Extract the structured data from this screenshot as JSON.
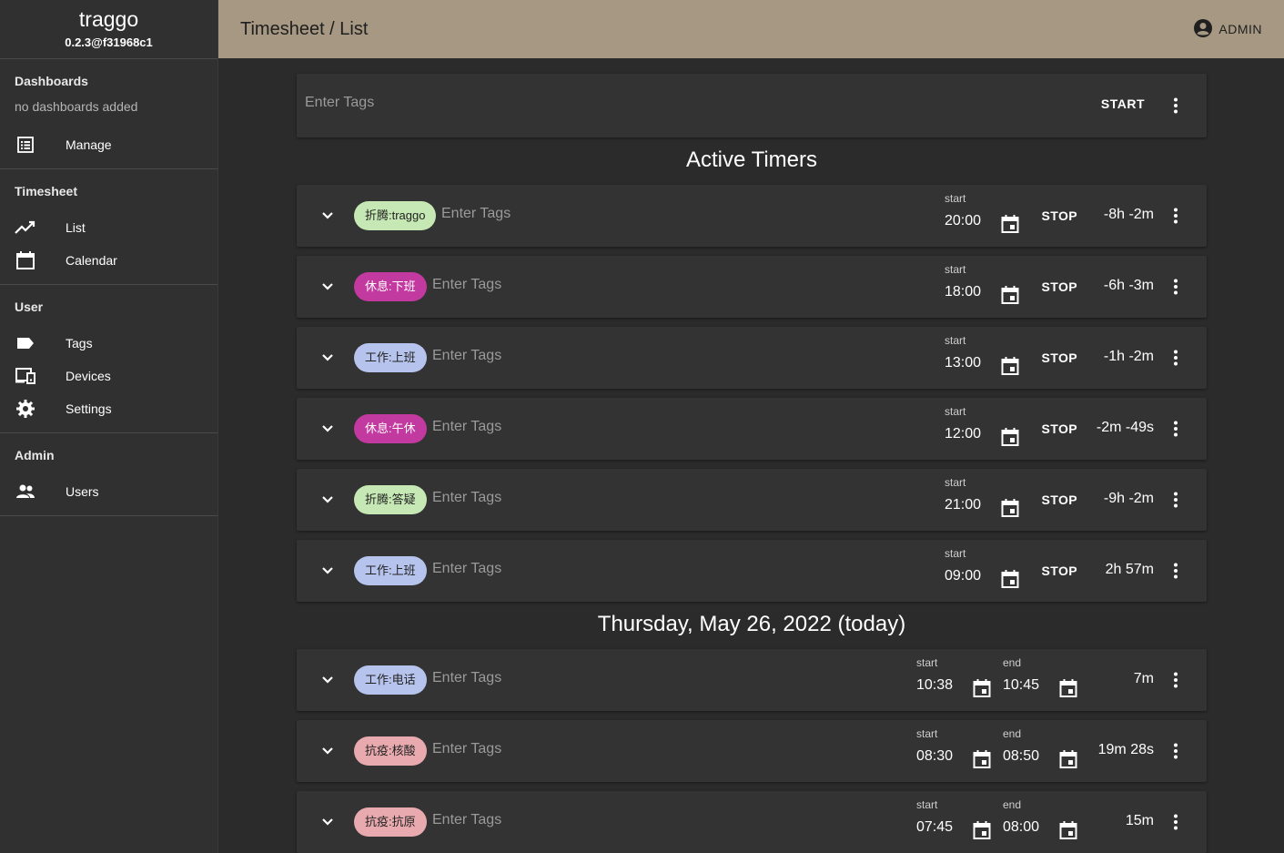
{
  "app": {
    "title": "traggo",
    "version": "0.2.3@f31968c1"
  },
  "sidebar": {
    "dashboards": {
      "heading": "Dashboards",
      "note": "no dashboards added",
      "items": [
        {
          "label": "Manage",
          "icon": "list-icon"
        }
      ]
    },
    "timesheet": {
      "heading": "Timesheet",
      "items": [
        {
          "label": "List",
          "icon": "trending-icon"
        },
        {
          "label": "Calendar",
          "icon": "calendar-icon"
        }
      ]
    },
    "user": {
      "heading": "User",
      "items": [
        {
          "label": "Tags",
          "icon": "label-icon"
        },
        {
          "label": "Devices",
          "icon": "devices-icon"
        },
        {
          "label": "Settings",
          "icon": "gear-icon"
        }
      ]
    },
    "admin": {
      "heading": "Admin",
      "items": [
        {
          "label": "Users",
          "icon": "people-icon"
        }
      ]
    }
  },
  "header": {
    "title": "Timesheet / List",
    "user_label": "ADMIN"
  },
  "tracker": {
    "placeholder": "Enter Tags",
    "start_label": "START"
  },
  "active_section": {
    "title": "Active Timers"
  },
  "active_timers": [
    {
      "tag": "折腾:traggo",
      "tag_color": "#c5e8b4",
      "placeholder": "Enter Tags",
      "start_label": "start",
      "start": "20:00",
      "stop_label": "STOP",
      "duration": "-8h -2m"
    },
    {
      "tag": "休息:下班",
      "tag_color": "#c2399f",
      "placeholder": "Enter Tags",
      "start_label": "start",
      "start": "18:00",
      "stop_label": "STOP",
      "duration": "-6h -3m"
    },
    {
      "tag": "工作:上班",
      "tag_color": "#b6c3ec",
      "placeholder": "Enter Tags",
      "start_label": "start",
      "start": "13:00",
      "stop_label": "STOP",
      "duration": "-1h -2m"
    },
    {
      "tag": "休息:午休",
      "tag_color": "#c2399f",
      "placeholder": "Enter Tags",
      "start_label": "start",
      "start": "12:00",
      "stop_label": "STOP",
      "duration": "-2m -49s"
    },
    {
      "tag": "折腾:答疑",
      "tag_color": "#c5e8b4",
      "placeholder": "Enter Tags",
      "start_label": "start",
      "start": "21:00",
      "stop_label": "STOP",
      "duration": "-9h -2m"
    },
    {
      "tag": "工作:上班",
      "tag_color": "#b6c3ec",
      "placeholder": "Enter Tags",
      "start_label": "start",
      "start": "09:00",
      "stop_label": "STOP",
      "duration": "2h 57m"
    }
  ],
  "day_section": {
    "title": "Thursday, May 26, 2022 (today)"
  },
  "day_entries": [
    {
      "tag": "工作:电话",
      "tag_color": "#b6c3ec",
      "placeholder": "Enter Tags",
      "start_label": "start",
      "start": "10:38",
      "end_label": "end",
      "end": "10:45",
      "duration": "7m"
    },
    {
      "tag": "抗疫:核酸",
      "tag_color": "#e8aaaf",
      "placeholder": "Enter Tags",
      "start_label": "start",
      "start": "08:30",
      "end_label": "end",
      "end": "08:50",
      "duration": "19m 28s"
    },
    {
      "tag": "抗疫:抗原",
      "tag_color": "#e8aaaf",
      "placeholder": "Enter Tags",
      "start_label": "start",
      "start": "07:45",
      "end_label": "end",
      "end": "08:00",
      "duration": "15m"
    }
  ]
}
